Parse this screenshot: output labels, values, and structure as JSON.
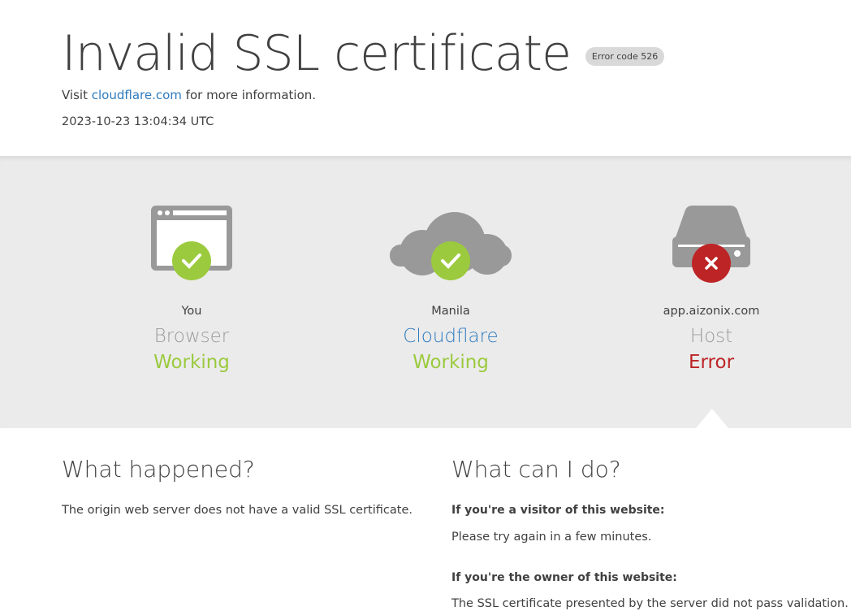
{
  "header": {
    "title": "Invalid SSL certificate",
    "error_code": "Error code 526",
    "visit_prefix": "Visit",
    "visit_link": "cloudflare.com",
    "visit_suffix": "for more information.",
    "timestamp": "2023-10-23 13:04:34 UTC"
  },
  "status": {
    "you": {
      "location": "You",
      "kind": "Browser",
      "state": "Working"
    },
    "cloudflare": {
      "location": "Manila",
      "kind": "Cloudflare",
      "state": "Working"
    },
    "host": {
      "location": "app.aizonix.com",
      "kind": "Host",
      "state": "Error"
    }
  },
  "colors": {
    "ok": "#9bca3e",
    "error": "#bd2426",
    "link": "#2f7bbf",
    "icon_gray": "#999999"
  },
  "what_happened": {
    "heading": "What happened?",
    "text": "The origin web server does not have a valid SSL certificate."
  },
  "what_can_i_do": {
    "heading": "What can I do?",
    "visitor_heading": "If you're a visitor of this website:",
    "visitor_text": "Please try again in a few minutes.",
    "owner_heading": "If you're the owner of this website:",
    "owner_text": "The SSL certificate presented by the server did not pass validation."
  }
}
